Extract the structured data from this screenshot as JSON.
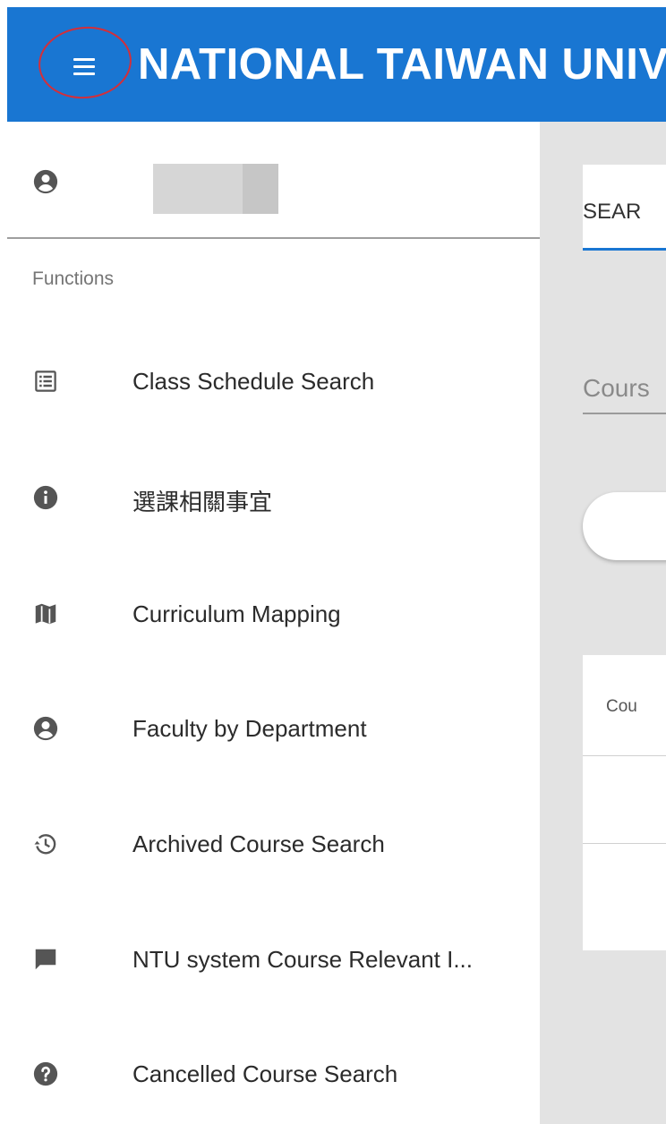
{
  "header": {
    "title": "NATIONAL TAIWAN UNIVERSITY",
    "menu_icon": "hamburger-menu-icon",
    "color": "#1976d2"
  },
  "drawer": {
    "user_icon": "account-circle-icon",
    "section_label": "Functions",
    "items": [
      {
        "label": "Class Schedule Search",
        "icon": "list-box-icon"
      },
      {
        "label": "選課相關事宜",
        "icon": "info-icon"
      },
      {
        "label": "Curriculum Mapping",
        "icon": "map-icon"
      },
      {
        "label": "Faculty by Department",
        "icon": "account-circle-icon"
      },
      {
        "label": "Archived Course Search",
        "icon": "history-icon"
      },
      {
        "label": "NTU system Course Relevant I...",
        "icon": "chat-bubble-icon"
      },
      {
        "label": "Cancelled Course Search",
        "icon": "help-icon"
      }
    ]
  },
  "main": {
    "tab_label": "SEAR",
    "field_label": "Cours",
    "table_header": "Cou"
  }
}
